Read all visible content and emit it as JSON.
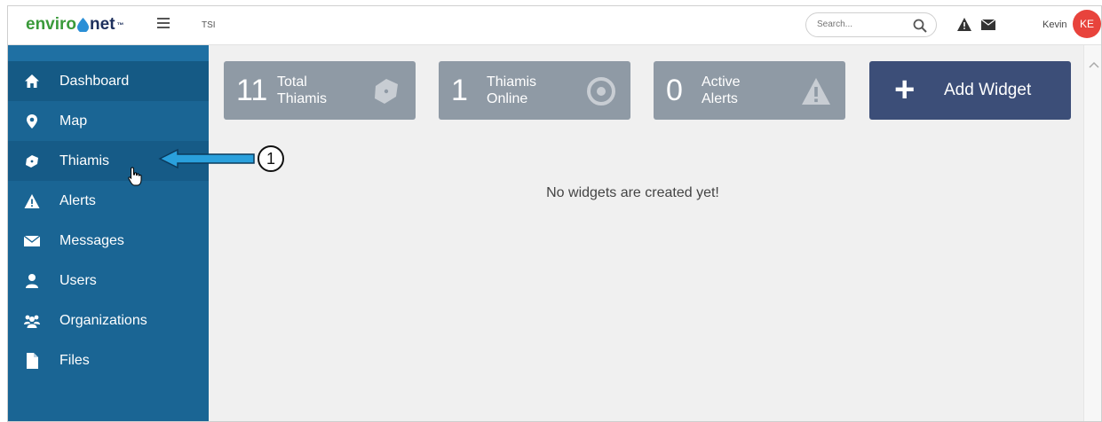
{
  "header": {
    "logo_part1": "enviro",
    "logo_part2": "net",
    "logo_tm": "™",
    "org": "TSI",
    "search_placeholder": "Search...",
    "user_name": "Kevin",
    "user_initials": "KE"
  },
  "sidebar": {
    "items": [
      {
        "label": "Dashboard",
        "icon": "home-icon"
      },
      {
        "label": "Map",
        "icon": "map-marker-icon"
      },
      {
        "label": "Thiamis",
        "icon": "thiamis-device-icon"
      },
      {
        "label": "Alerts",
        "icon": "warning-icon"
      },
      {
        "label": "Messages",
        "icon": "envelope-icon"
      },
      {
        "label": "Users",
        "icon": "user-icon"
      },
      {
        "label": "Organizations",
        "icon": "users-group-icon"
      },
      {
        "label": "Files",
        "icon": "file-icon"
      }
    ]
  },
  "cards": [
    {
      "number": "11",
      "label1": "Total",
      "label2": "Thiamis",
      "icon": "thiamis-device-icon"
    },
    {
      "number": "1",
      "label1": "Thiamis",
      "label2": "Online",
      "icon": "target-icon"
    },
    {
      "number": "0",
      "label1": "Active",
      "label2": "Alerts",
      "icon": "warning-icon"
    }
  ],
  "add_widget": {
    "label": "Add Widget"
  },
  "empty_message": "No widgets are created yet!",
  "callout": {
    "number": "1"
  },
  "colors": {
    "sidebar": "#1a6594",
    "card": "#8f9aa5",
    "add_widget": "#3c4e78",
    "arrow": "#2aa0dc",
    "avatar": "#e8433c"
  }
}
